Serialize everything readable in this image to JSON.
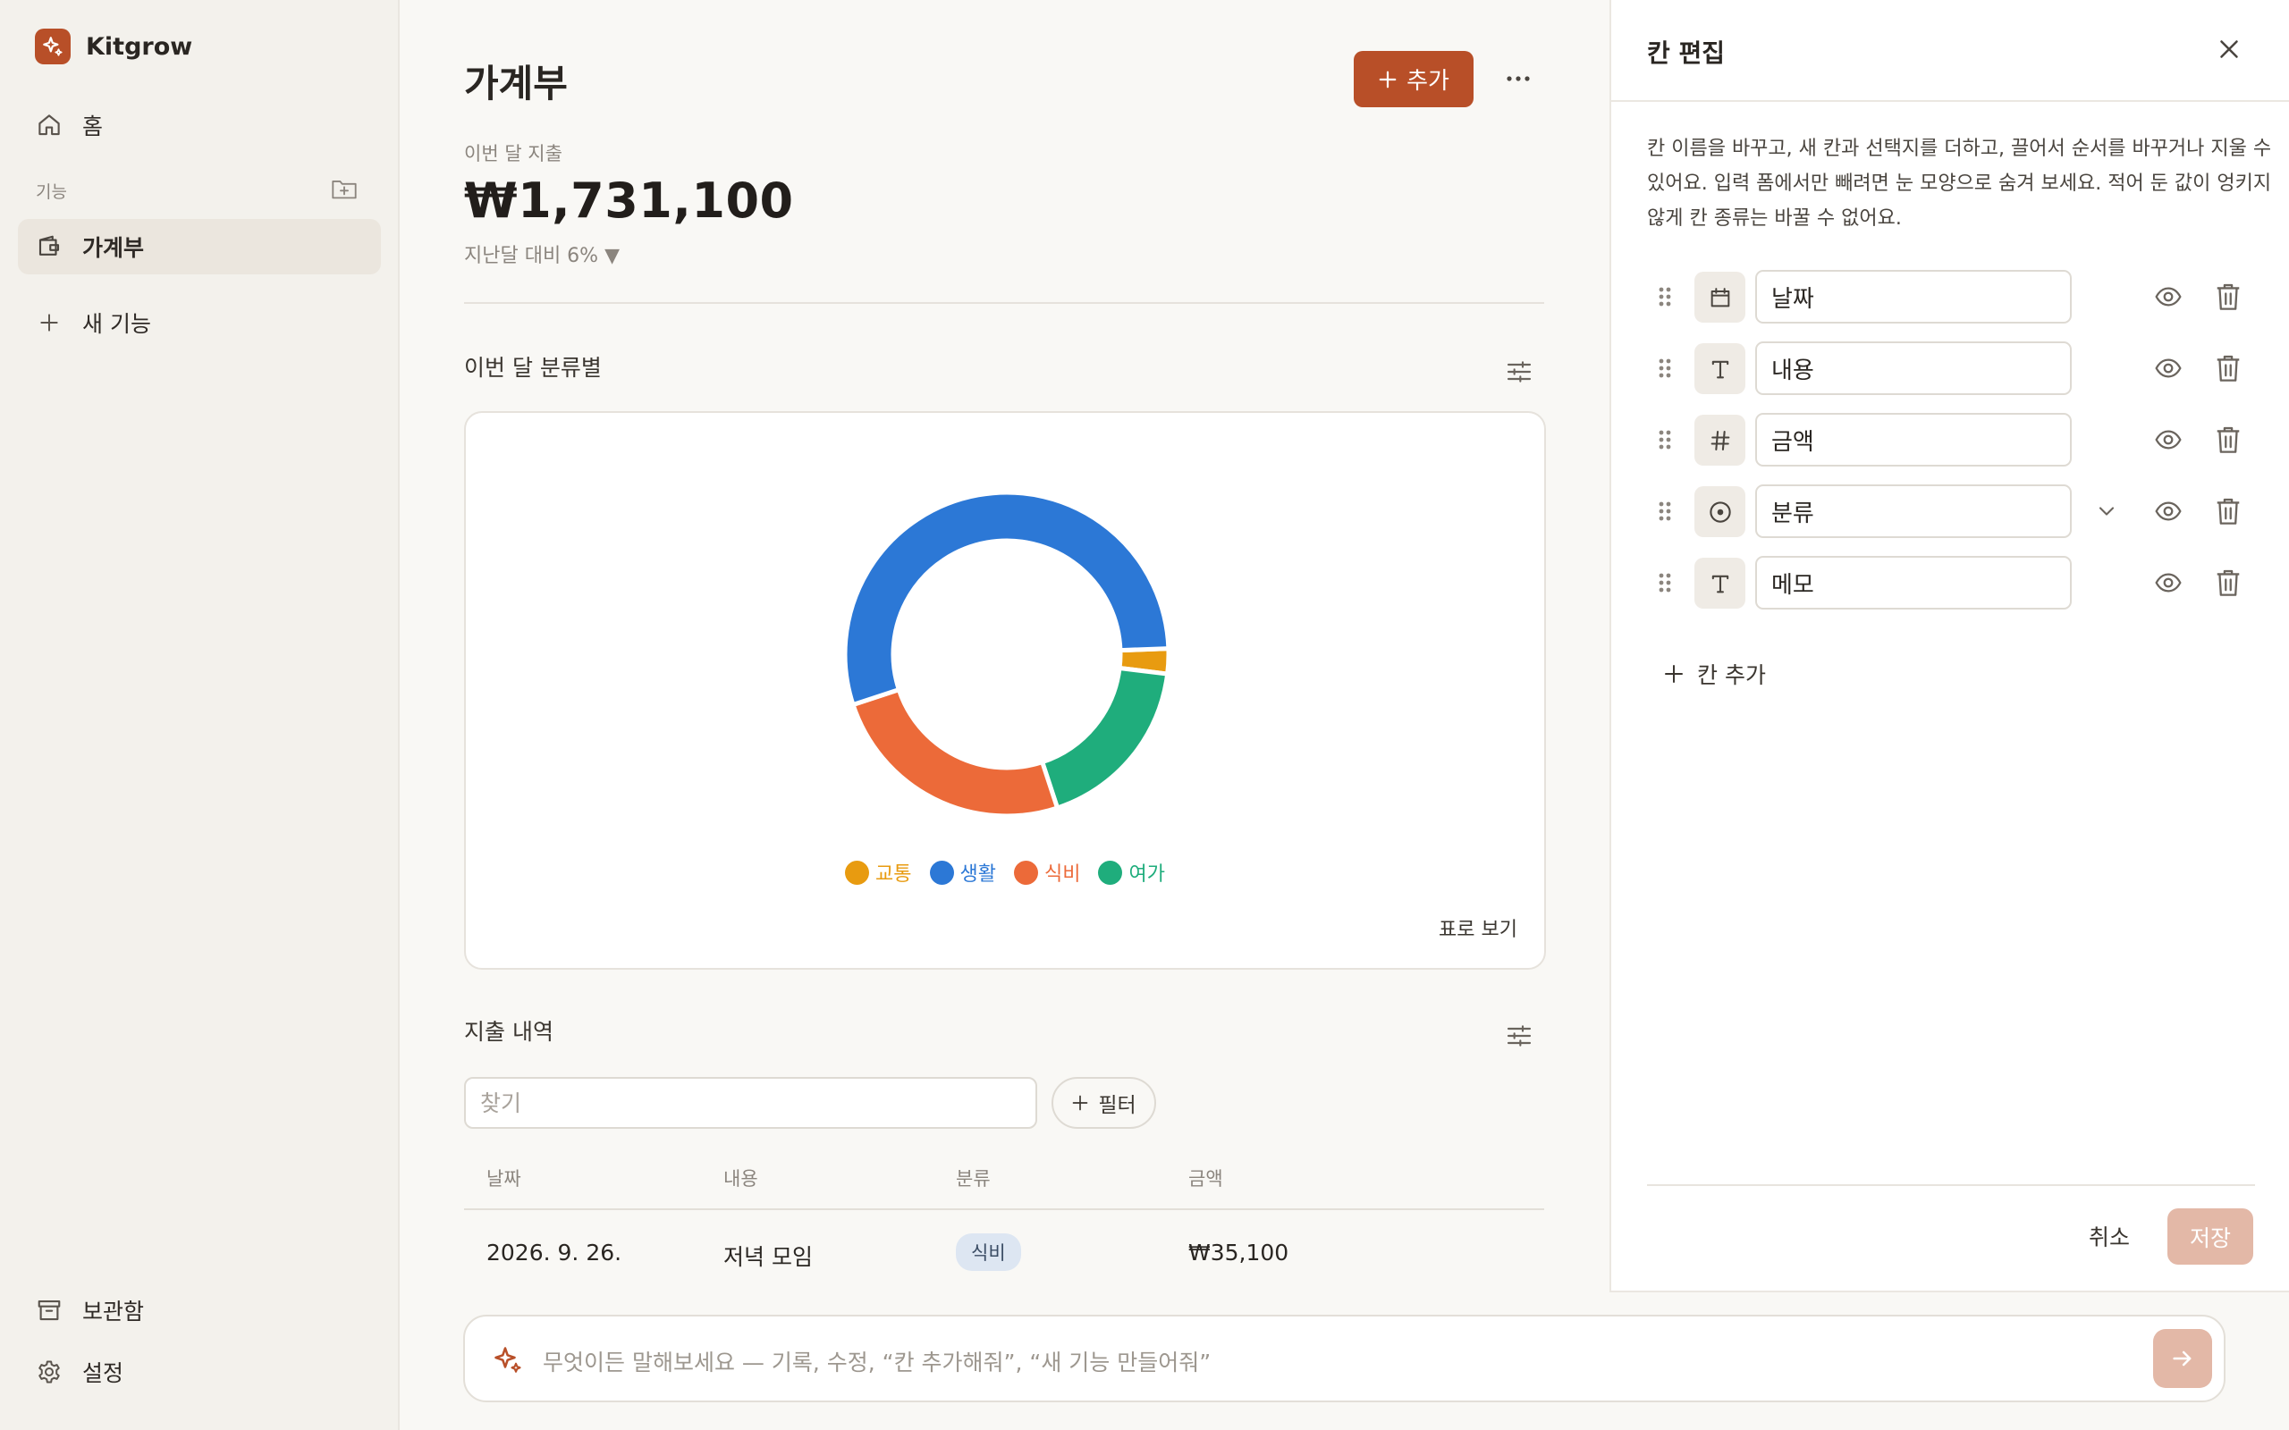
{
  "app": {
    "name": "Kitgrow"
  },
  "sidebar": {
    "home": "홈",
    "section_label": "기능",
    "items": [
      {
        "label": "가계부",
        "active": true
      }
    ],
    "new_feature": "새 기능",
    "archive": "보관함",
    "settings": "설정"
  },
  "header": {
    "title": "가계부",
    "add_label": "추가"
  },
  "summary": {
    "label": "이번 달 지출",
    "value": "₩1,731,100",
    "delta": "지난달 대비 6% ▼"
  },
  "chart_section": {
    "title": "이번 달 분류별",
    "table_view": "표로 보기"
  },
  "chart_data": {
    "type": "pie",
    "style": "donut",
    "categories": [
      "교통",
      "생활",
      "식비",
      "여가"
    ],
    "values": [
      2.5,
      54.5,
      25.0,
      18.0
    ],
    "start_angle_deg": 88,
    "slice_order": [
      "교통",
      "여가",
      "식비",
      "생활"
    ],
    "colors": {
      "교통": "#e89b10",
      "생활": "#2c78d6",
      "식비": "#ec6a39",
      "여가": "#1fad7c"
    },
    "title": "",
    "legend_position": "bottom"
  },
  "list_section": {
    "title": "지출 내역",
    "search_placeholder": "찾기",
    "filter_label": "필터",
    "columns": [
      "날짜",
      "내용",
      "분류",
      "금액"
    ],
    "rows": [
      {
        "date": "2026. 9. 26.",
        "content": "저녁 모임",
        "category": "식비",
        "amount": "₩35,100"
      }
    ]
  },
  "composer": {
    "placeholder": "무엇이든 말해보세요 — 기록, 수정, “칸 추가해줘”, “새 기능 만들어줘”"
  },
  "panel": {
    "title": "칸 편집",
    "description": "칸 이름을 바꾸고, 새 칸과 선택지를 더하고, 끌어서 순서를 바꾸거나 지울 수 있어요. 입력 폼에서만 빼려면 눈 모양으로 숨겨 보세요. 적어 둔 값이 엉키지 않게 칸 종류는 바꿀 수 없어요.",
    "fields": [
      {
        "name": "날짜",
        "type_icon": "calendar-icon"
      },
      {
        "name": "내용",
        "type_icon": "text-type-icon"
      },
      {
        "name": "금액",
        "type_icon": "hash-icon"
      },
      {
        "name": "분류",
        "type_icon": "select-circle-icon",
        "expandable": true
      },
      {
        "name": "메모",
        "type_icon": "text-type-icon"
      }
    ],
    "add_column": "칸 추가",
    "cancel": "취소",
    "save": "저장"
  },
  "colors": {
    "accent": "#b84f28",
    "accent_disabled": "#e3b8a7",
    "background": "#f9f8f5",
    "sidebar": "#f3f1ec"
  }
}
